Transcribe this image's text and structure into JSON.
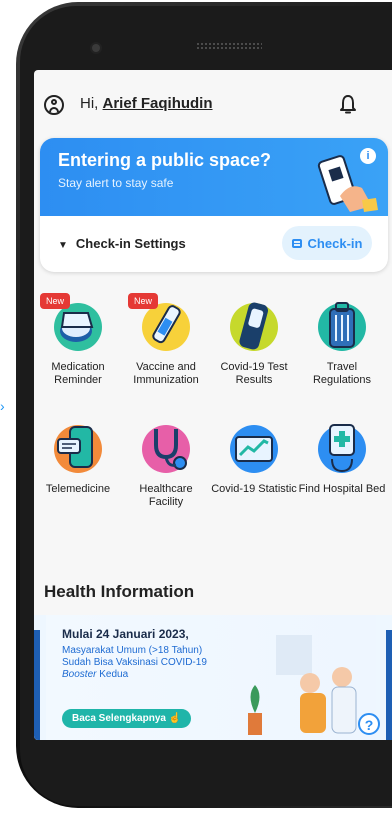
{
  "header": {
    "greeting": "Hi,",
    "user_name": "Arief Faqihudin"
  },
  "checkin_card": {
    "title": "Entering a public space?",
    "subtitle": "Stay alert to stay safe",
    "info_label": "i",
    "settings_label": "Check-in Settings",
    "checkin_button": "Check-in"
  },
  "menu": {
    "badge_new": "New",
    "items": [
      {
        "label": "Medication Reminder",
        "icon": "medication-icon",
        "new": true
      },
      {
        "label": "Vaccine and Immunization",
        "icon": "vaccine-icon",
        "new": true
      },
      {
        "label": "Covid-19 Test Results",
        "icon": "test-results-icon",
        "new": false
      },
      {
        "label": "Travel Regulations",
        "icon": "luggage-icon",
        "new": false
      },
      {
        "label": "Telemedicine",
        "icon": "telemedicine-icon",
        "new": false
      },
      {
        "label": "Healthcare Facility",
        "icon": "stethoscope-icon",
        "new": false
      },
      {
        "label": "Covid-19 Statistic",
        "icon": "statistic-icon",
        "new": false
      },
      {
        "label": "Find Hospital Bed",
        "icon": "hospital-bed-icon",
        "new": false
      }
    ]
  },
  "health_info": {
    "title": "Health Information",
    "banner": {
      "headline": "Mulai 24 Januari 2023,",
      "line1": "Masyarakat Umum (>18 Tahun)",
      "line2": "Sudah Bisa Vaksinasi COVID-19",
      "line3_italic": "Booster",
      "line3_rest": " Kedua",
      "button": "Baca Selengkapnya"
    },
    "help_label": "?"
  },
  "colors": {
    "accent_blue": "#2d8ef2",
    "badge_red": "#e53935",
    "teal_button": "#1fb5a9"
  }
}
